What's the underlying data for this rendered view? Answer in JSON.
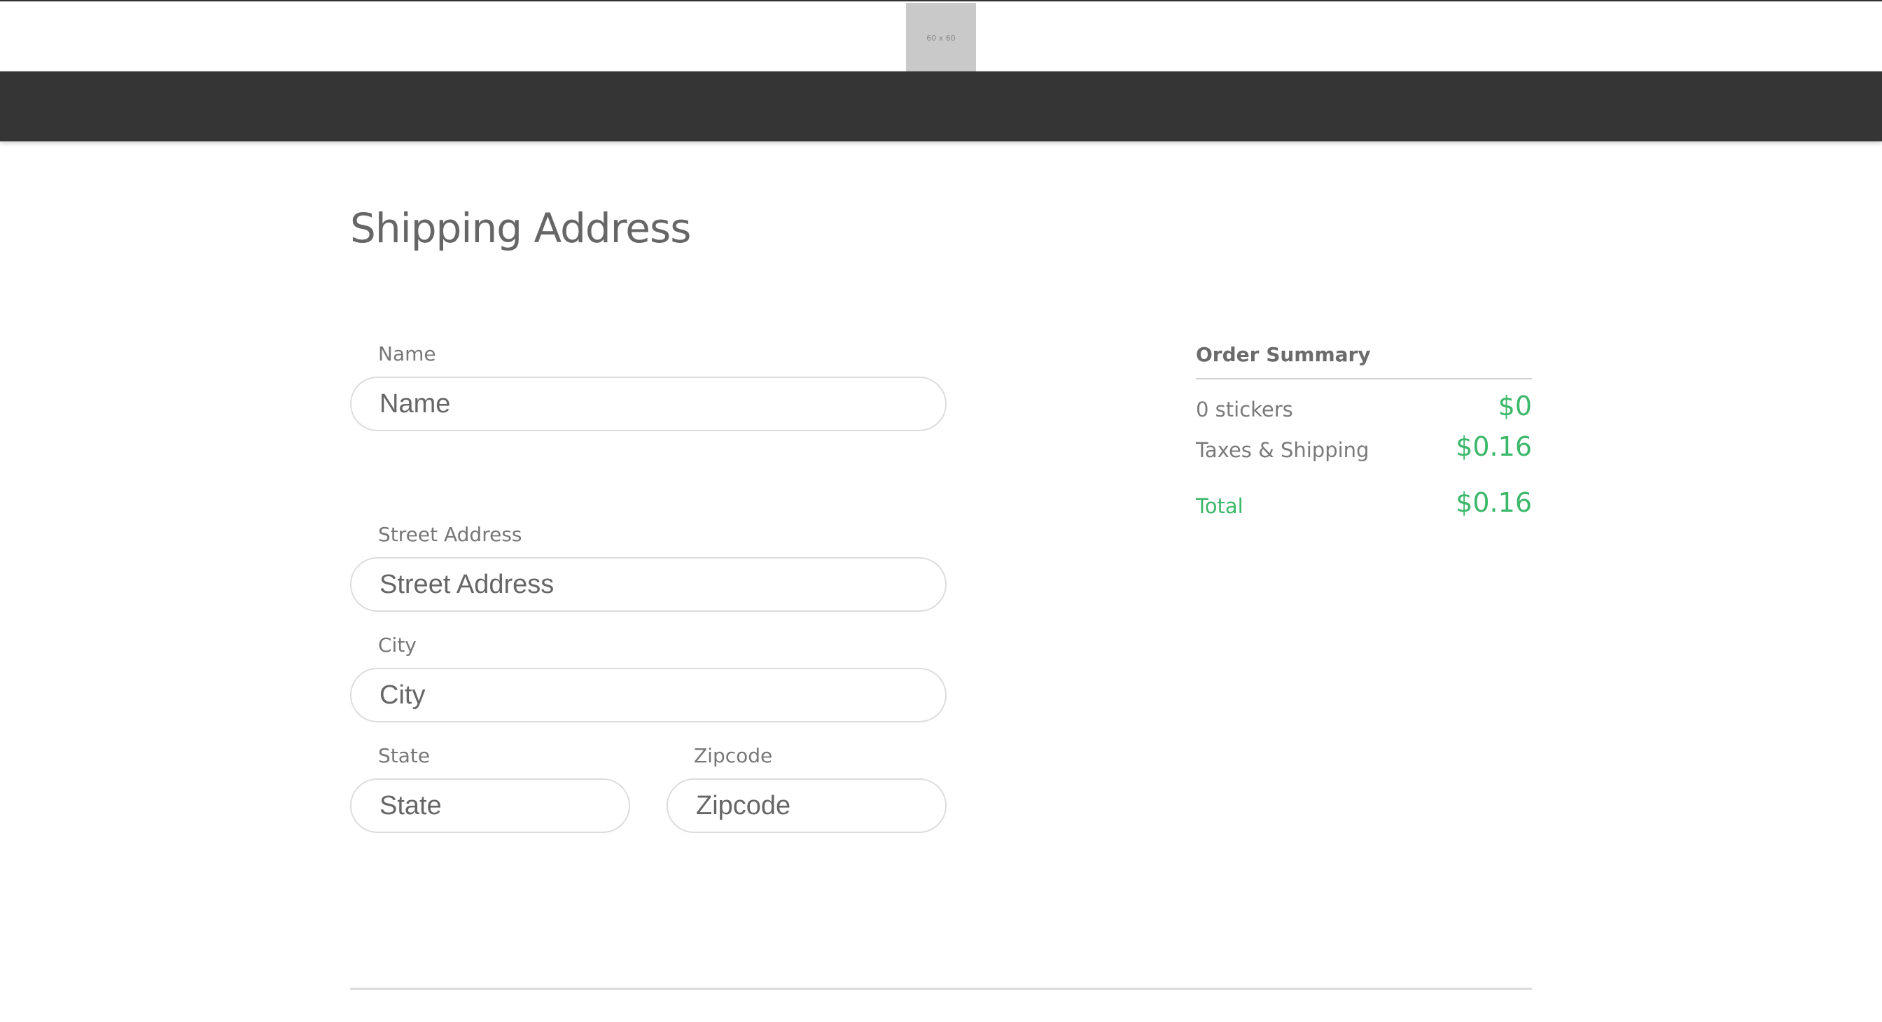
{
  "header": {
    "logo_text": "60 x 60"
  },
  "page": {
    "title": "Shipping Address"
  },
  "form": {
    "name": {
      "label": "Name",
      "placeholder": "Name",
      "value": ""
    },
    "street": {
      "label": "Street Address",
      "placeholder": "Street Address",
      "value": ""
    },
    "city": {
      "label": "City",
      "placeholder": "City",
      "value": ""
    },
    "state": {
      "label": "State",
      "placeholder": "State",
      "value": ""
    },
    "zipcode": {
      "label": "Zipcode",
      "placeholder": "Zipcode",
      "value": ""
    }
  },
  "summary": {
    "title": "Order Summary",
    "rows": [
      {
        "label": "0 stickers",
        "value": "$0"
      },
      {
        "label": "Taxes & Shipping",
        "value": "$0.16"
      }
    ],
    "total": {
      "label": "Total",
      "value": "$0.16"
    }
  },
  "colors": {
    "navbar": "#353535",
    "accent_green": "#3cb86a",
    "placeholder_logo": "#c9c9c9"
  }
}
